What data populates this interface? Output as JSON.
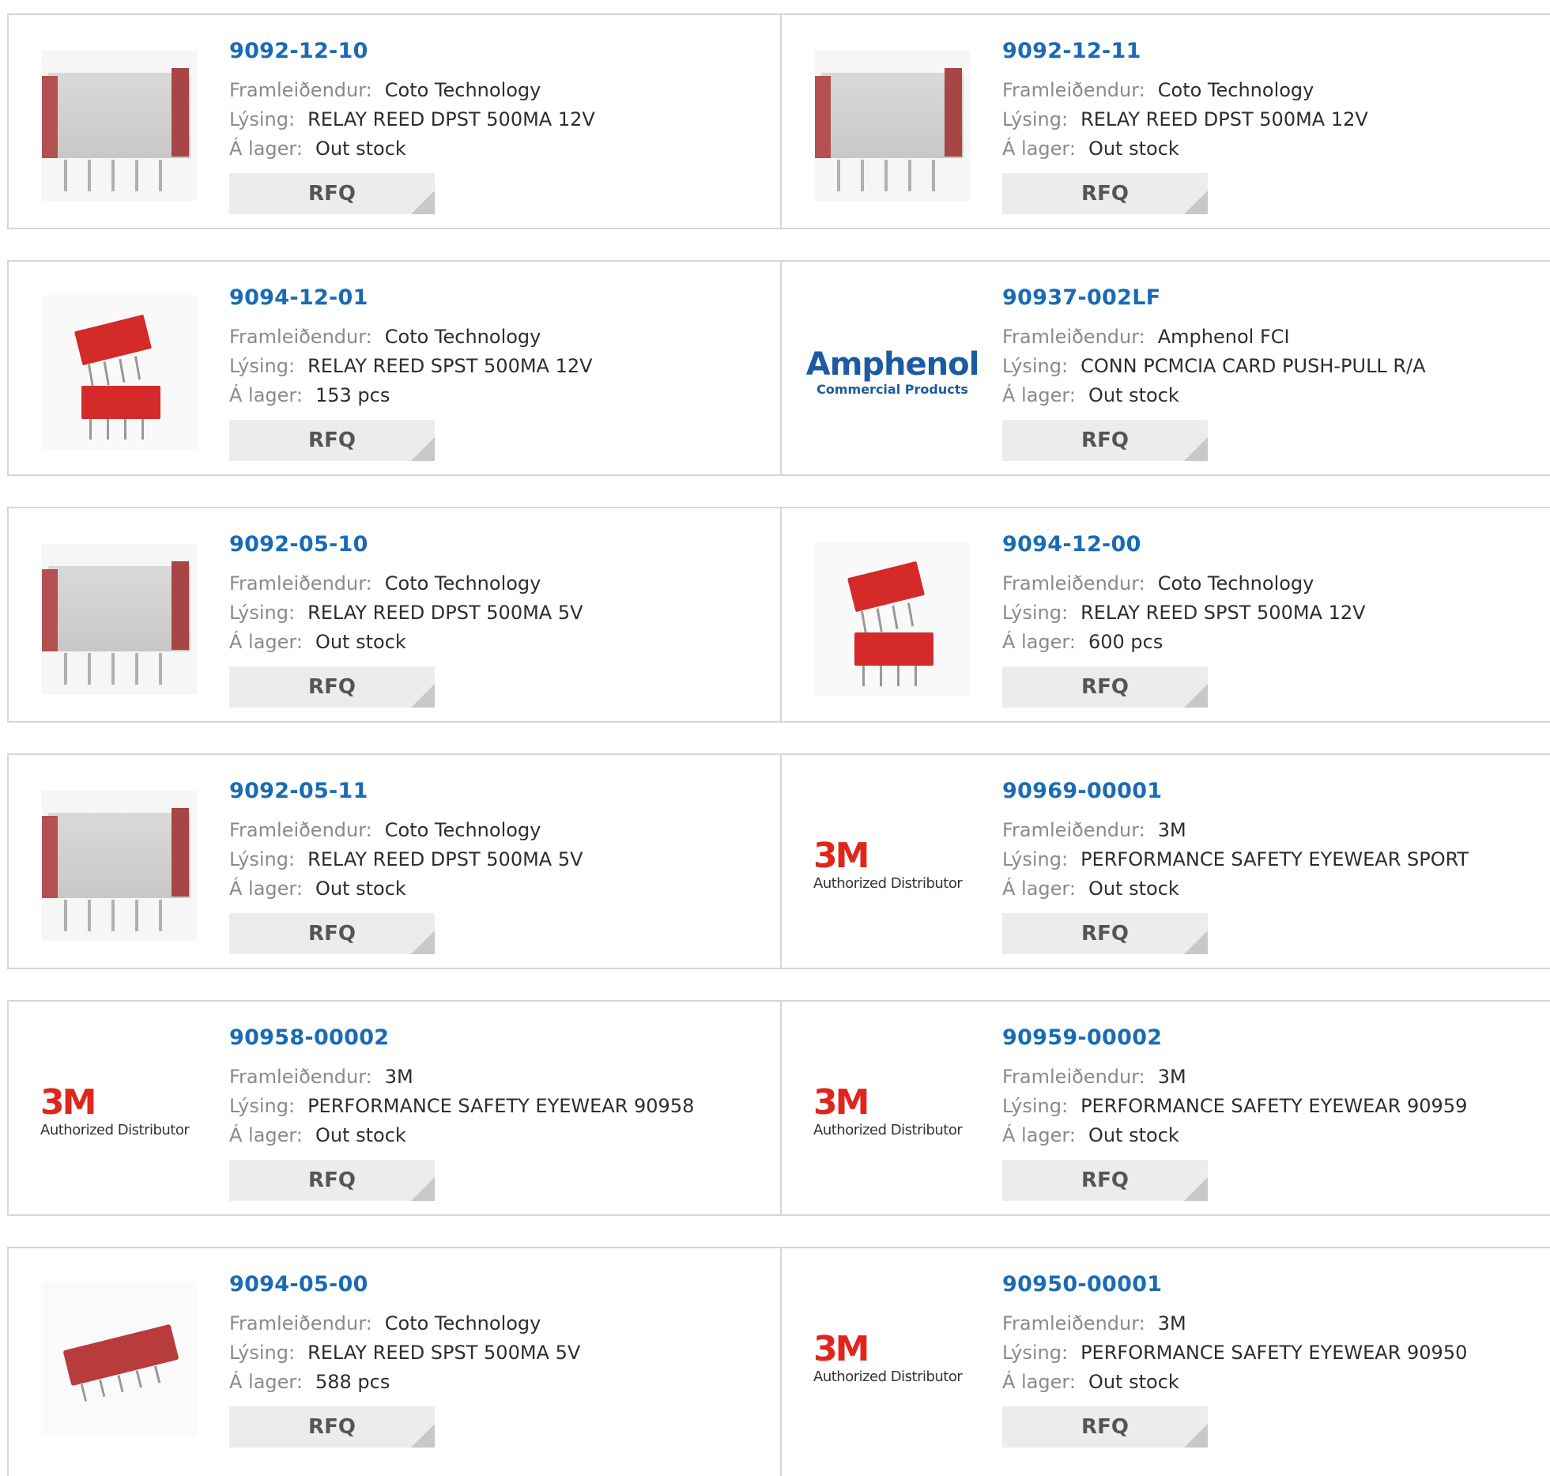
{
  "labels": {
    "manufacturer": "Framleiðendur:",
    "description": "Lýsing:",
    "stock": "Á lager:",
    "rfq": "RFQ"
  },
  "logos": {
    "amphenol_line1": "Amphenol",
    "amphenol_line2": "Commercial Products",
    "threem_line1": "3M",
    "threem_line2": "Authorized Distributor"
  },
  "colors": {
    "part_number": "#1a6bb5",
    "label": "#8a8a8a",
    "rfq_bg": "#ececec"
  },
  "products": [
    {
      "part": "9092-12-10",
      "manufacturer": "Coto Technology",
      "description": "RELAY REED DPST 500MA 12V",
      "stock": "Out stock",
      "image": "relay-dpst-icon"
    },
    {
      "part": "9092-12-11",
      "manufacturer": "Coto Technology",
      "description": "RELAY REED DPST 500MA 12V",
      "stock": "Out stock",
      "image": "relay-dpst-icon"
    },
    {
      "part": "9094-12-01",
      "manufacturer": "Coto Technology",
      "description": "RELAY REED SPST 500MA 12V",
      "stock": "153 pcs",
      "image": "relay-spst-icon"
    },
    {
      "part": "90937-002LF",
      "manufacturer": "Amphenol FCI",
      "description": "CONN PCMCIA CARD PUSH-PULL R/A",
      "stock": "Out stock",
      "image": "amphenol-logo"
    },
    {
      "part": "9092-05-10",
      "manufacturer": "Coto Technology",
      "description": "RELAY REED DPST 500MA 5V",
      "stock": "Out stock",
      "image": "relay-dpst-icon"
    },
    {
      "part": "9094-12-00",
      "manufacturer": "Coto Technology",
      "description": "RELAY REED SPST 500MA 12V",
      "stock": "600 pcs",
      "image": "relay-spst-icon"
    },
    {
      "part": "9092-05-11",
      "manufacturer": "Coto Technology",
      "description": "RELAY REED DPST 500MA 5V",
      "stock": "Out stock",
      "image": "relay-dpst-icon"
    },
    {
      "part": "90969-00001",
      "manufacturer": "3M",
      "description": "PERFORMANCE SAFETY EYEWEAR SPORT",
      "stock": "Out stock",
      "image": "3m-logo"
    },
    {
      "part": "90958-00002",
      "manufacturer": "3M",
      "description": "PERFORMANCE SAFETY EYEWEAR 90958",
      "stock": "Out stock",
      "image": "3m-logo"
    },
    {
      "part": "90959-00002",
      "manufacturer": "3M",
      "description": "PERFORMANCE SAFETY EYEWEAR 90959",
      "stock": "Out stock",
      "image": "3m-logo"
    },
    {
      "part": "9094-05-00",
      "manufacturer": "Coto Technology",
      "description": "RELAY REED SPST 500MA 5V",
      "stock": "588 pcs",
      "image": "relay-flat-icon"
    },
    {
      "part": "90950-00001",
      "manufacturer": "3M",
      "description": "PERFORMANCE SAFETY EYEWEAR 90950",
      "stock": "Out stock",
      "image": "3m-logo"
    }
  ]
}
